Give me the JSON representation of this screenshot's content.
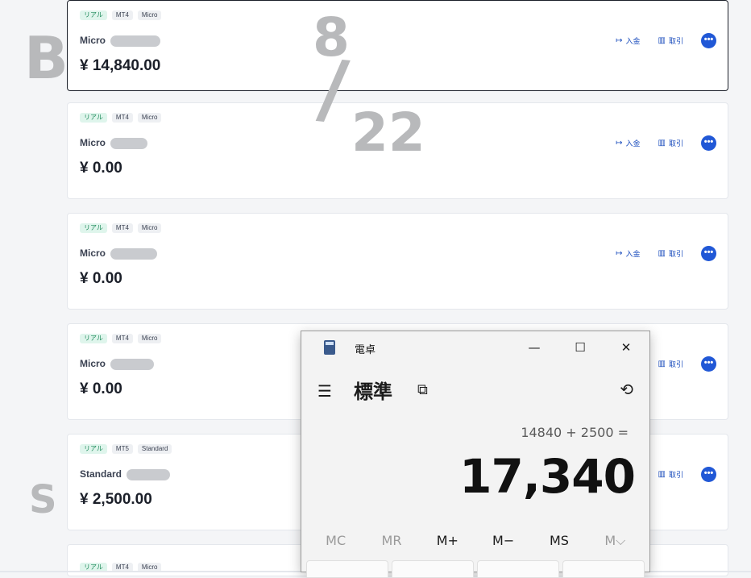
{
  "accounts": [
    {
      "tags": [
        "リアル",
        "MT4",
        "Micro"
      ],
      "name": "Micro",
      "balance": "¥ 14,840.00"
    },
    {
      "tags": [
        "リアル",
        "MT4",
        "Micro"
      ],
      "name": "Micro",
      "balance": "¥ 0.00"
    },
    {
      "tags": [
        "リアル",
        "MT4",
        "Micro"
      ],
      "name": "Micro",
      "balance": "¥ 0.00"
    },
    {
      "tags": [
        "リアル",
        "MT4",
        "Micro"
      ],
      "name": "Micro",
      "balance": "¥ 0.00"
    },
    {
      "tags": [
        "リアル",
        "MT5",
        "Standard"
      ],
      "name": "Standard",
      "balance": "¥ 2,500.00"
    },
    {
      "tags": [
        "リアル",
        "MT4",
        "Micro"
      ],
      "name": "",
      "balance": ""
    }
  ],
  "actions": {
    "deposit": "入金",
    "trade": "取引",
    "more_glyph": "•••"
  },
  "annotations": {
    "b": "B",
    "date_top": "8",
    "date_slash": "/",
    "date_bottom": "22",
    "s": "S"
  },
  "calculator": {
    "window_title": "電卓",
    "mode": "標準",
    "expression": "14840 + 2500 =",
    "result": "17,340",
    "memory_buttons": [
      "MC",
      "MR",
      "M+",
      "M−",
      "MS",
      "M⌵"
    ]
  },
  "colors": {
    "accent": "#2158d6",
    "tag_real": "#1f8a5b",
    "scribble": "#b8b9bb"
  }
}
